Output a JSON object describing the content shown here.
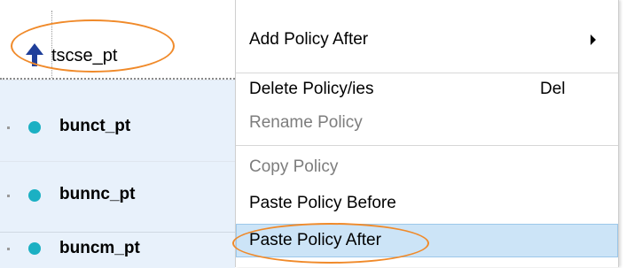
{
  "policy_list": {
    "selected_item": {
      "name": "tscse_pt",
      "icon": "up-arrow-icon"
    },
    "items": [
      {
        "name": "bunct_pt"
      },
      {
        "name": "bunnc_pt"
      },
      {
        "name": "buncm_pt"
      }
    ]
  },
  "context_menu": {
    "items": [
      {
        "label": "Add Policy After",
        "has_submenu": true,
        "enabled": true
      },
      {
        "label": "Delete Policy/ies",
        "shortcut": "Del",
        "enabled": true
      },
      {
        "label": "Rename Policy",
        "enabled": false
      },
      {
        "label": "Copy Policy",
        "enabled": false
      },
      {
        "label": "Paste Policy Before",
        "enabled": true
      },
      {
        "label": "Paste Policy After",
        "enabled": true,
        "highlighted": true
      }
    ]
  },
  "colors": {
    "annotation": "#f08a2a",
    "highlight": "#cce4f7",
    "row_background": "#e8f1fb",
    "status_dot": "#1bb0c3",
    "arrow": "#1f3f9a"
  }
}
